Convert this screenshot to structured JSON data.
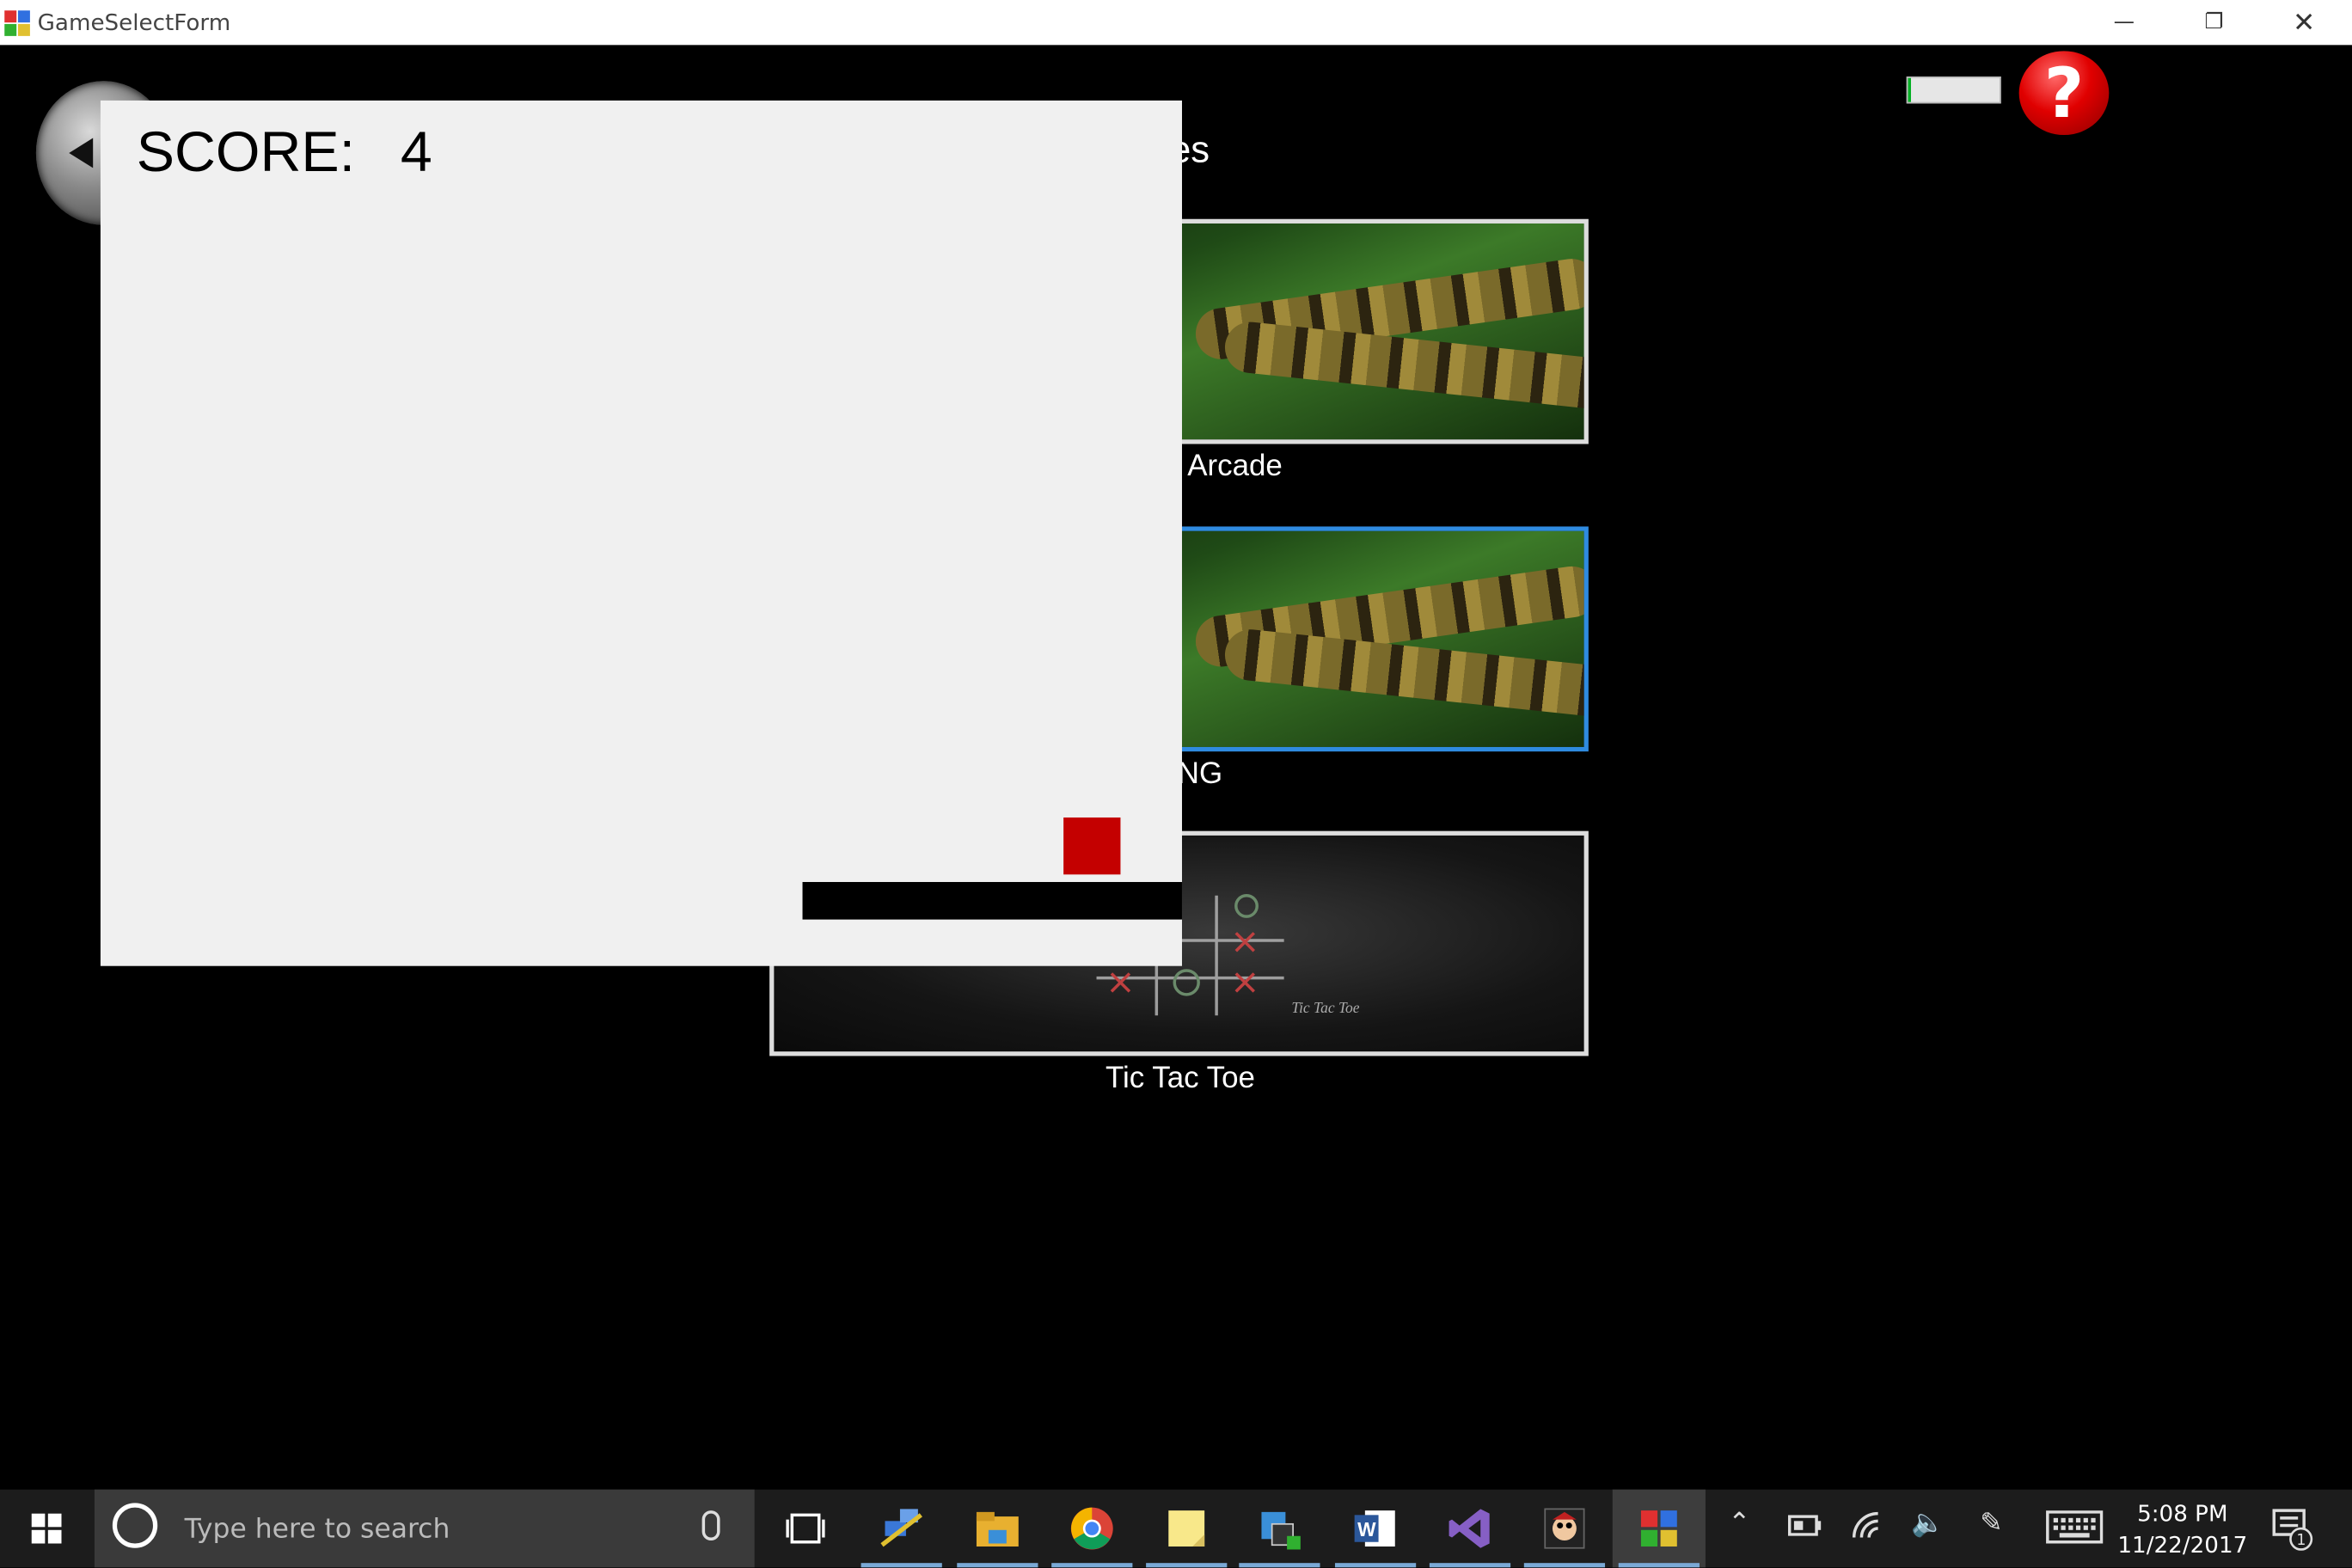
{
  "window": {
    "title": "GameSelectForm",
    "minimize_icon": "minimize-icon",
    "restore_icon": "restore-icon",
    "close_icon": "close-icon"
  },
  "background": {
    "heading_fragment": "es",
    "games": [
      {
        "caption": "e Arcade",
        "thumbnail": "snake-thumbnail",
        "selected": false
      },
      {
        "caption": "NG",
        "thumbnail": "snake-thumbnail",
        "selected": true
      },
      {
        "caption": "Tic Tac Toe",
        "thumbnail": "tic-tac-toe-thumbnail",
        "selected": false,
        "thumb_text": "Tic Tac Toe"
      }
    ]
  },
  "score_panel": {
    "score_label": "SCORE:",
    "score_value": "4",
    "paddle_color": "#000000",
    "ball_color": "#c40000"
  },
  "toolbar": {
    "back_icon": "back-arrow-icon",
    "progress_fraction": 0.03,
    "help_symbol": "?"
  },
  "taskbar": {
    "search_placeholder": "Type here to search",
    "apps": [
      "task-view-icon",
      "network-app-icon",
      "file-explorer-icon",
      "chrome-icon",
      "sticky-notes-icon",
      "security-app-icon",
      "word-icon",
      "visual-studio-icon",
      "game-app-icon",
      "game-select-form-icon"
    ],
    "clock_time": "5:08 PM",
    "clock_date": "11/22/2017",
    "notification_count": "1",
    "accent": "#7aa9d6"
  }
}
